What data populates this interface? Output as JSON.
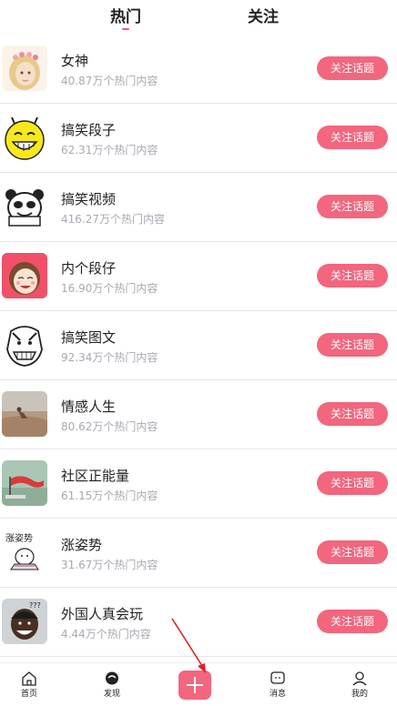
{
  "tabs": {
    "hot": "热门",
    "follow": "关注"
  },
  "topics": [
    {
      "title": "女神",
      "sub": "40.87万个热门内容",
      "button": "关注话题",
      "icon": "goddess-avatar-icon"
    },
    {
      "title": "搞笑段子",
      "sub": "62.31万个热门内容",
      "button": "关注话题",
      "icon": "laughing-face-icon"
    },
    {
      "title": "搞笑视频",
      "sub": "416.27万个热门内容",
      "button": "关注话题",
      "icon": "panda-meme-icon"
    },
    {
      "title": "内个段仔",
      "sub": "16.90万个热门内容",
      "button": "关注话题",
      "icon": "cartoon-girl-icon"
    },
    {
      "title": "搞笑图文",
      "sub": "92.34万个热门内容",
      "button": "关注话题",
      "icon": "rage-face-icon"
    },
    {
      "title": "情感人生",
      "sub": "80.62万个热门内容",
      "button": "关注话题",
      "icon": "beach-photo-icon"
    },
    {
      "title": "社区正能量",
      "sub": "61.15万个热门内容",
      "button": "关注话题",
      "icon": "flag-photo-icon"
    },
    {
      "title": "涨姿势",
      "sub": "31.67万个热门内容",
      "button": "关注话题",
      "icon": "sketch-doodle-icon"
    },
    {
      "title": "外国人真会玩",
      "sub": "4.44万个热门内容",
      "button": "关注话题",
      "icon": "man-meme-icon"
    }
  ],
  "doodle_text": "涨姿势",
  "meme_text": "???",
  "nav": {
    "home": "首页",
    "discover": "发现",
    "messages": "消息",
    "me": "我的"
  },
  "colors": {
    "accent": "#f2667e",
    "underline": "#ef5a7c",
    "subtext": "#a9a9b3"
  }
}
